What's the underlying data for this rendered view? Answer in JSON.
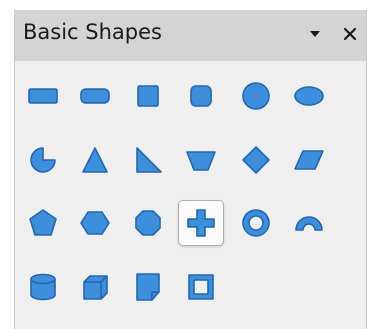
{
  "panel": {
    "title": "Basic Shapes",
    "menu_icon": "triangle-down-icon",
    "close_icon": "close-icon"
  },
  "colors": {
    "shape_fill": "#3d8edb",
    "shape_stroke": "#2567ad",
    "panel_bg": "#efefef",
    "titlebar_bg": "#d4d4d4"
  },
  "shapes": [
    {
      "name": "rectangle",
      "icon": "rectangle-icon"
    },
    {
      "name": "rectangle-rounded",
      "icon": "rounded-rectangle-icon"
    },
    {
      "name": "square",
      "icon": "square-icon"
    },
    {
      "name": "square-rounded",
      "icon": "rounded-square-icon"
    },
    {
      "name": "circle",
      "icon": "circle-icon"
    },
    {
      "name": "ellipse",
      "icon": "ellipse-icon"
    },
    {
      "name": "circle-pie",
      "icon": "circle-pie-icon"
    },
    {
      "name": "isosceles-triangle",
      "icon": "isosceles-triangle-icon"
    },
    {
      "name": "right-triangle",
      "icon": "right-triangle-icon"
    },
    {
      "name": "trapezoid",
      "icon": "trapezoid-icon"
    },
    {
      "name": "diamond",
      "icon": "diamond-icon"
    },
    {
      "name": "parallelogram",
      "icon": "parallelogram-icon"
    },
    {
      "name": "pentagon",
      "icon": "pentagon-icon"
    },
    {
      "name": "hexagon",
      "icon": "hexagon-icon"
    },
    {
      "name": "octagon",
      "icon": "octagon-icon"
    },
    {
      "name": "cross",
      "icon": "cross-icon",
      "hovered": true
    },
    {
      "name": "ring",
      "icon": "ring-icon"
    },
    {
      "name": "block-arc",
      "icon": "block-arc-icon"
    },
    {
      "name": "cylinder",
      "icon": "cylinder-icon"
    },
    {
      "name": "cube",
      "icon": "cube-icon"
    },
    {
      "name": "folded-corner",
      "icon": "folded-corner-icon"
    },
    {
      "name": "frame",
      "icon": "frame-icon"
    }
  ]
}
